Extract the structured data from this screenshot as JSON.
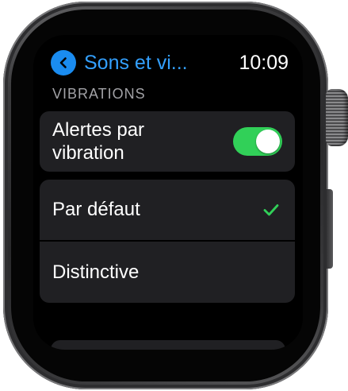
{
  "watch": {
    "back_title": "Sons et vi...",
    "time": "10:09"
  },
  "vibrations": {
    "section_header": "VIBRATIONS",
    "alerts_label": "Alertes par vibration",
    "alerts_enabled": true,
    "options": [
      {
        "label": "Par défaut",
        "selected": true
      },
      {
        "label": "Distinctive",
        "selected": false
      }
    ]
  },
  "icons": {
    "back": "chevron-left-icon",
    "selected": "checkmark-icon"
  },
  "colors": {
    "accent_blue": "#1a8cf0",
    "title_blue": "#33a0ff",
    "toggle_green": "#31d058",
    "check_green": "#31d058",
    "cell_background": "#202023",
    "section_header": "#a2a2a6"
  }
}
